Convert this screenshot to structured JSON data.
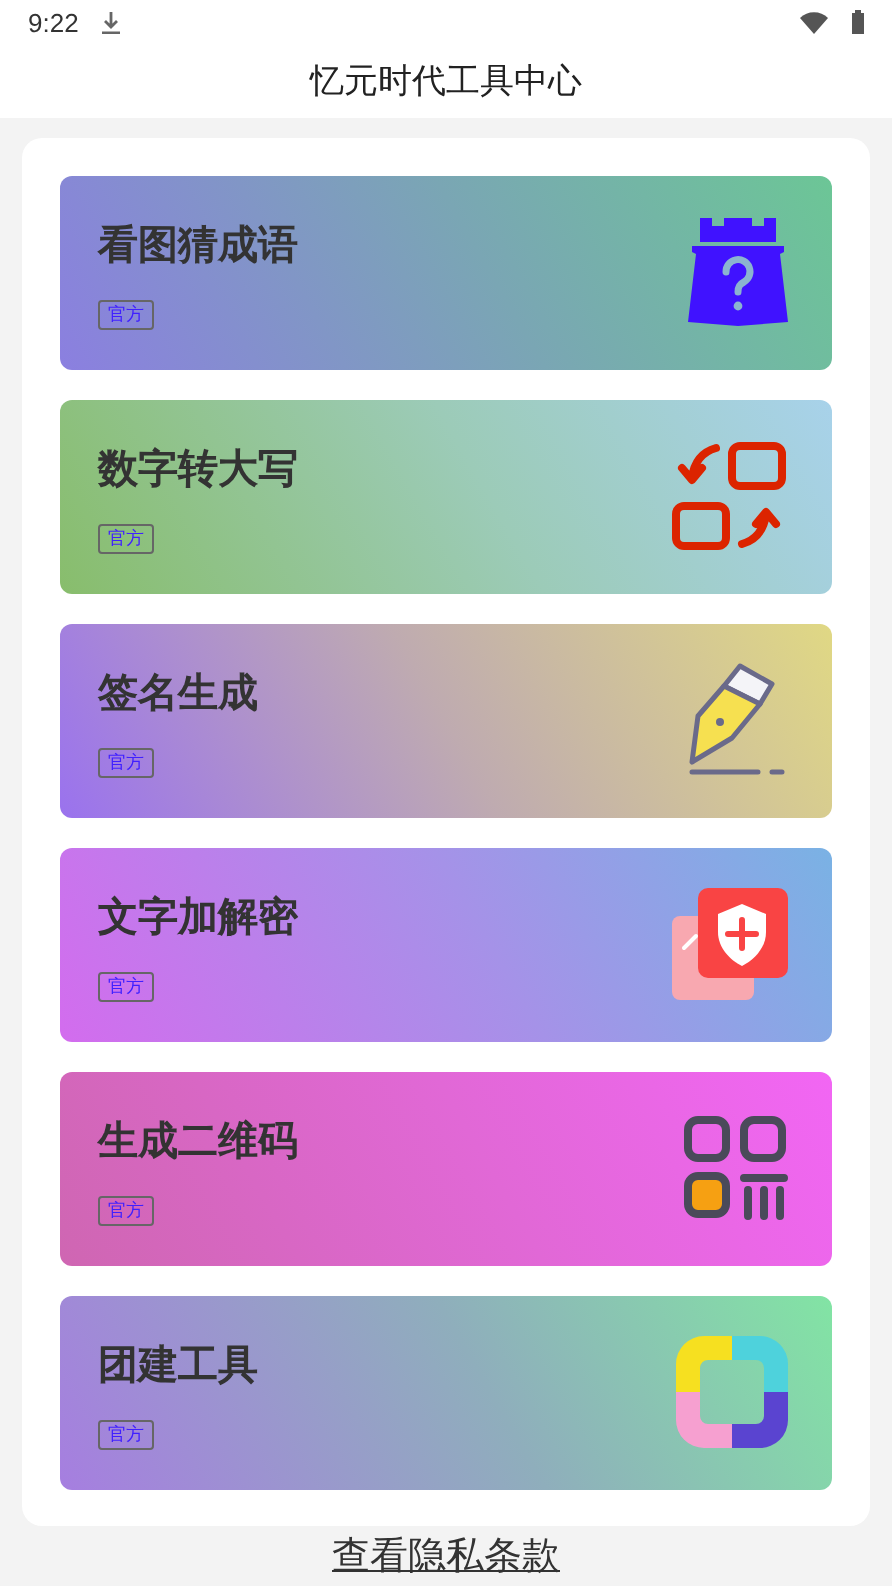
{
  "status_bar": {
    "time": "9:22"
  },
  "title": "忆元时代工具中心",
  "tools": [
    {
      "kind": "idiom",
      "title": "看图猜成语",
      "badge": "官方"
    },
    {
      "kind": "number",
      "title": "数字转大写",
      "badge": "官方"
    },
    {
      "kind": "signature",
      "title": "签名生成",
      "badge": "官方"
    },
    {
      "kind": "crypto",
      "title": "文字加解密",
      "badge": "官方"
    },
    {
      "kind": "qrcode",
      "title": "生成二维码",
      "badge": "官方"
    },
    {
      "kind": "team",
      "title": "团建工具",
      "badge": "官方"
    }
  ],
  "privacy_link": "查看隐私条款"
}
